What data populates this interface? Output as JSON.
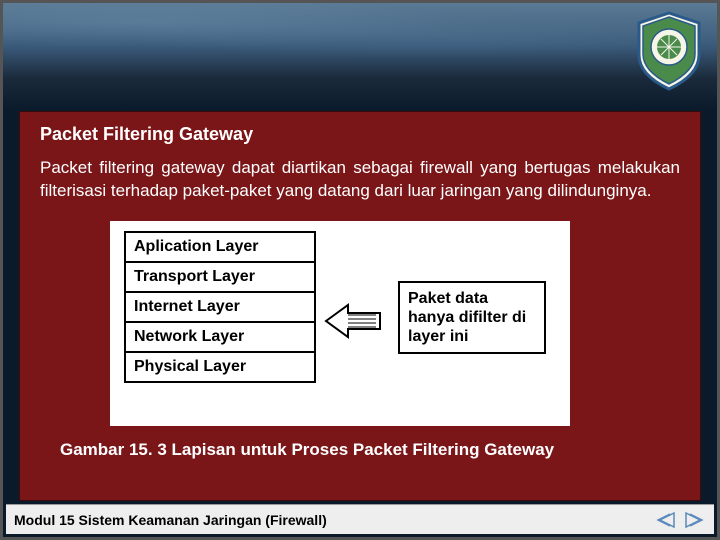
{
  "header": {
    "logo_name": "emblem-logo"
  },
  "content": {
    "heading": "Packet Filtering Gateway",
    "body": "Packet filtering gateway dapat diartikan sebagai firewall yang bertugas melakukan filterisasi terhadap paket-paket yang datang dari luar jaringan yang dilindunginya.",
    "layers": [
      "Aplication Layer",
      "Transport Layer",
      "Internet  Layer",
      "Network  Layer",
      "Physical Layer"
    ],
    "annotation": "Paket data hanya difilter di layer ini",
    "caption": "Gambar 15. 3 Lapisan untuk Proses Packet Filtering Gateway"
  },
  "footer": {
    "text": "Modul 15 Sistem Keamanan Jaringan (Firewall)"
  }
}
